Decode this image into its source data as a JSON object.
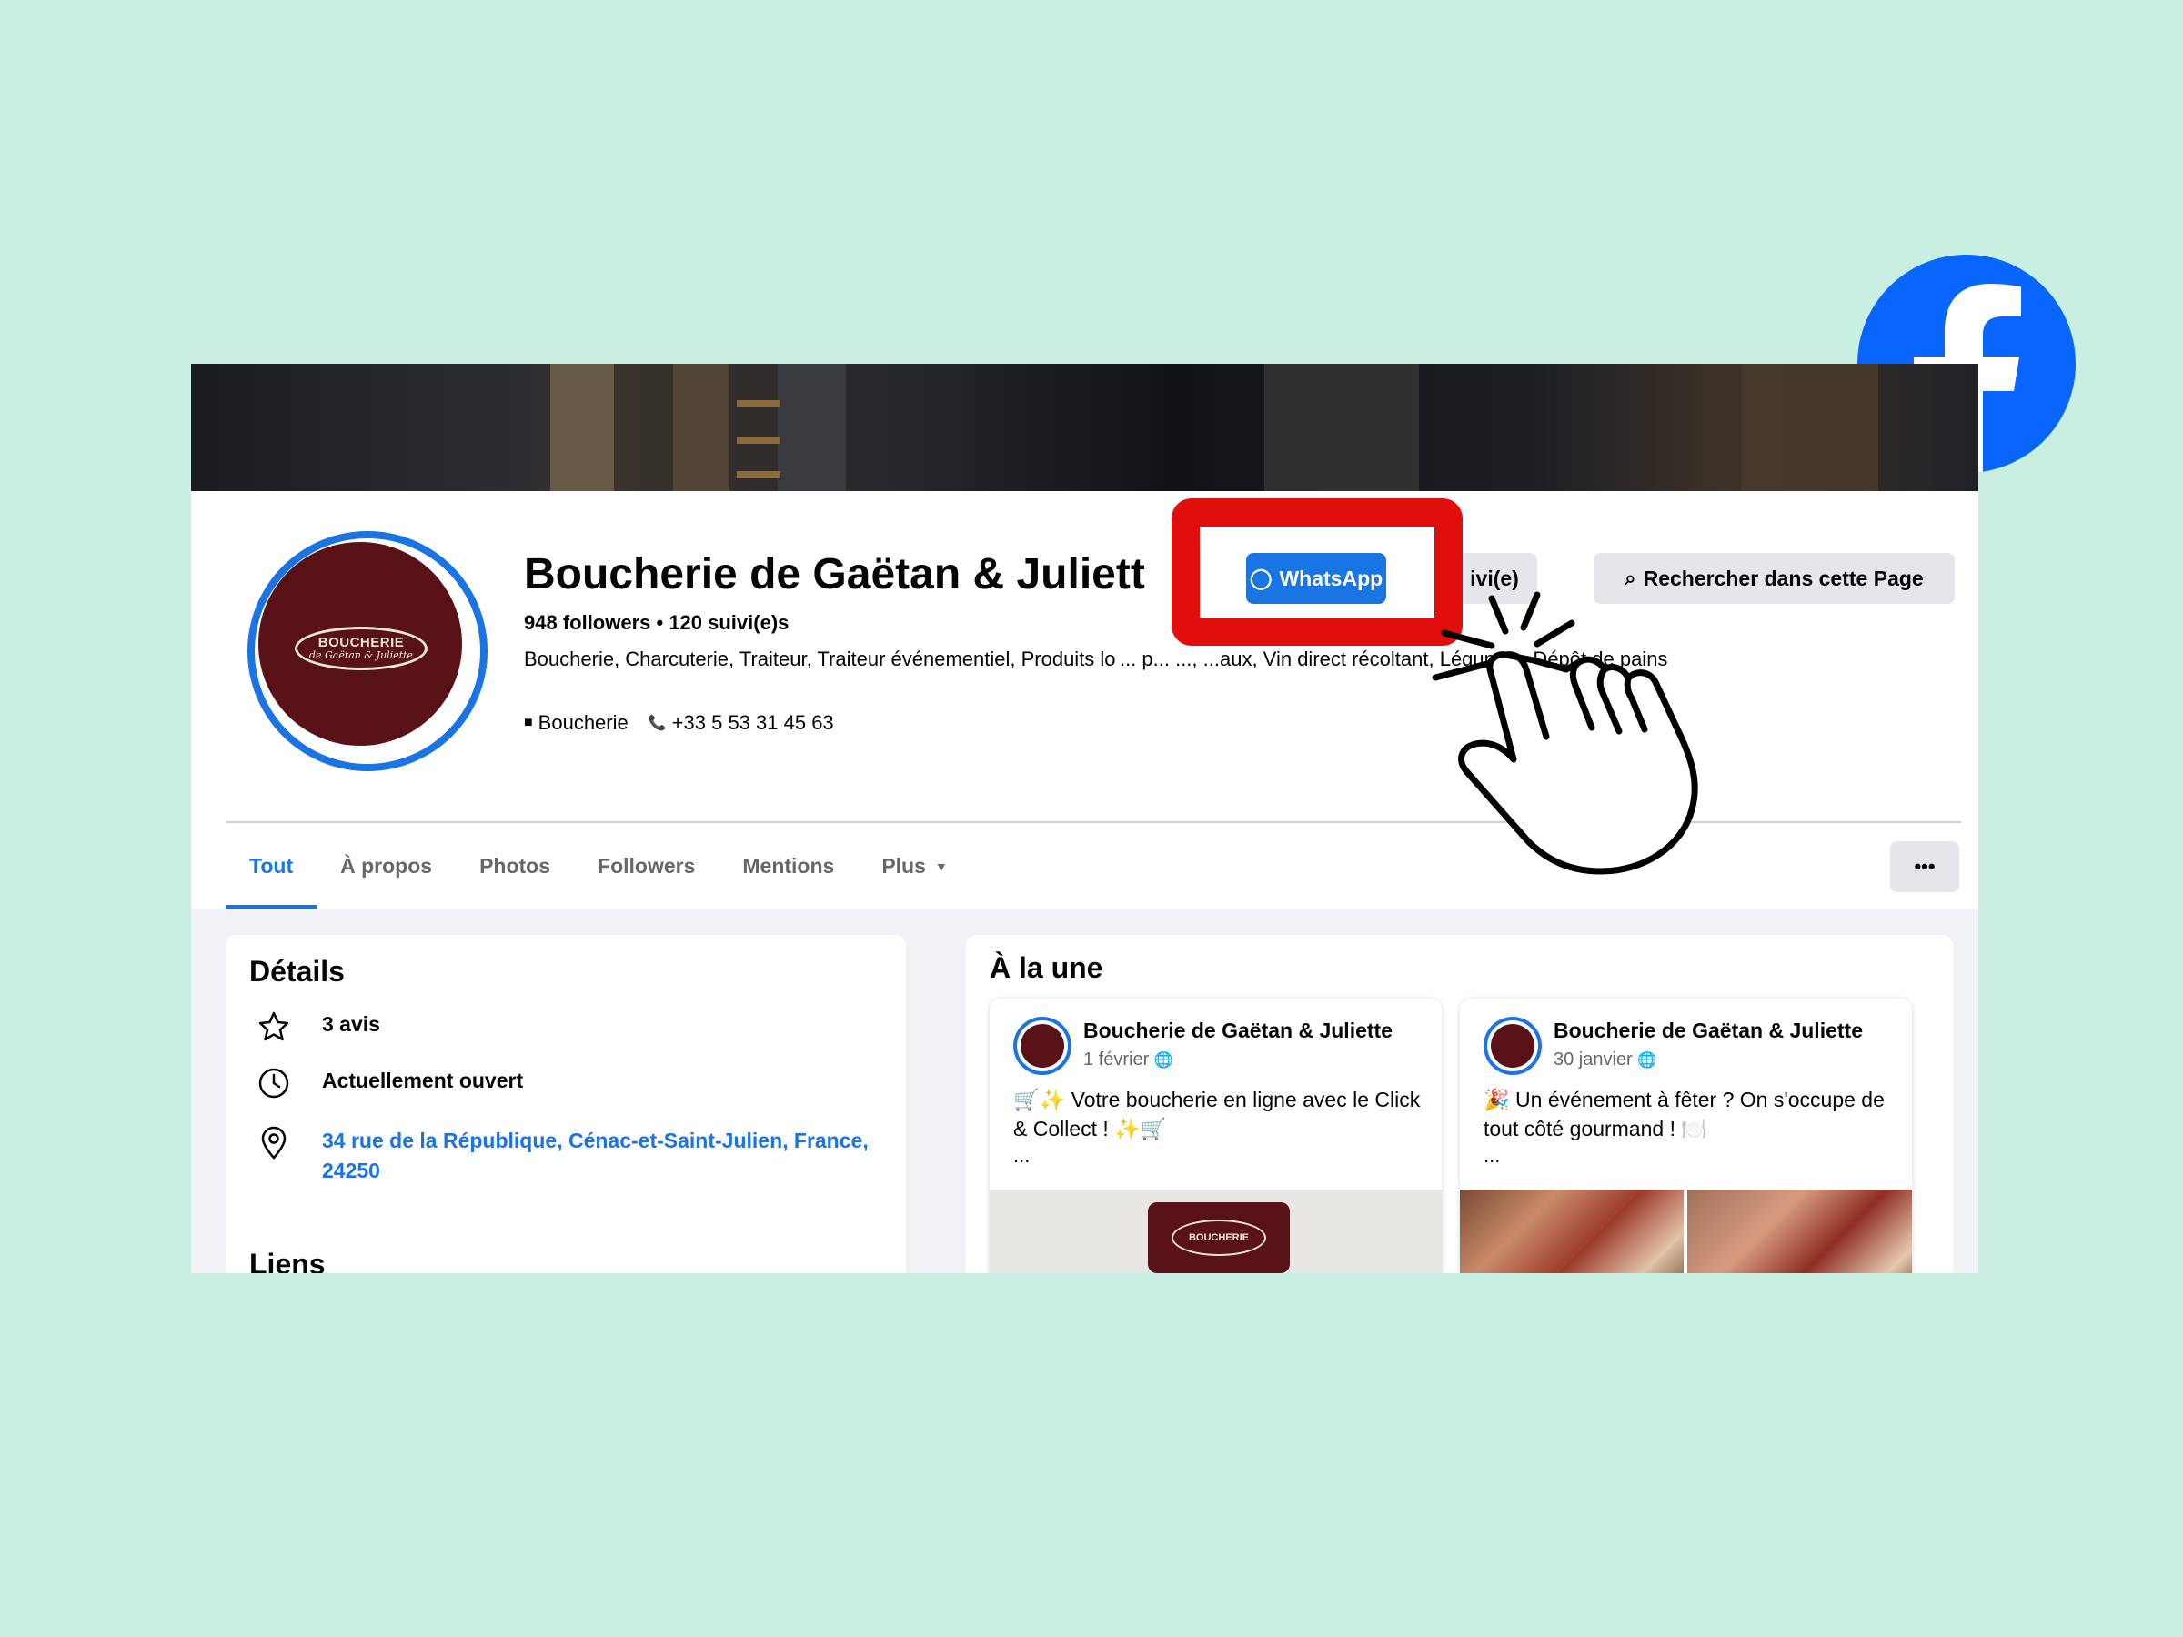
{
  "brand": {
    "logo_icon": "facebook-logo-icon",
    "accent": "#1b74e4",
    "highlight": "#e10e0e"
  },
  "page": {
    "name": "Boucherie de Gaëtan & Juliett",
    "stats": "948 followers • 120 suivi(e)s",
    "categories": "Boucherie, Charcuterie, Traiteur, Traiteur événementiel, Produits lo ... p... ..., ...aux, Vin direct récoltant, Légumes, Dépôt de pains",
    "category_badge": "Boucherie",
    "phone": "+33 5 53 31 45 63",
    "avatar_text_1": "BOUCHERIE",
    "avatar_text_2": "de Gaëtan & Juliette"
  },
  "actions": {
    "whatsapp": "WhatsApp",
    "follow": "ivi(e)",
    "search": "Rechercher dans cette Page"
  },
  "tabs": [
    {
      "label": "Tout",
      "active": true
    },
    {
      "label": "À propos"
    },
    {
      "label": "Photos"
    },
    {
      "label": "Followers"
    },
    {
      "label": "Mentions"
    },
    {
      "label": "Plus"
    }
  ],
  "more_label": "•••",
  "details": {
    "title": "Détails",
    "reviews": "3 avis",
    "status": "Actuellement ouvert",
    "address": "34 rue de la République, Cénac-et-Saint-Julien, France, 24250",
    "links_title": "Liens"
  },
  "featured": {
    "title": "À la une",
    "posts": [
      {
        "author": "Boucherie de Gaëtan & Juliette",
        "date": "1 février",
        "text": "🛒✨ Votre boucherie en ligne avec le Click & Collect ! ✨🛒",
        "ellipsis": "...",
        "image_text": "BOUCHERIE"
      },
      {
        "author": "Boucherie de Gaëtan & Juliette",
        "date": "30 janvier",
        "text": "🎉 Un événement à fêter ? On s'occupe de tout côté gourmand ! 🍽️",
        "ellipsis": "..."
      }
    ]
  }
}
